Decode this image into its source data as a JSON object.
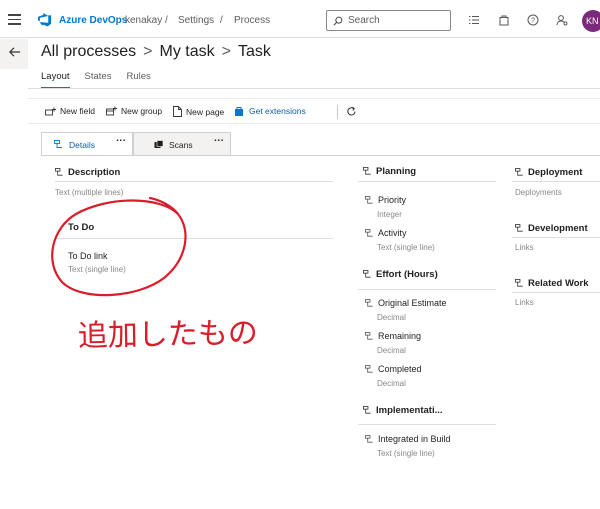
{
  "header": {
    "brand": "Azure DevOps",
    "org": "kenakay",
    "sep1": "/",
    "settings": "Settings",
    "sep2": "/",
    "process": "Process",
    "search_placeholder": "Search",
    "avatar_initials": "KN"
  },
  "breadcrumb": {
    "all": "All processes",
    "mytask": "My task",
    "task": "Task",
    "sep": ">"
  },
  "tabs": {
    "layout": "Layout",
    "states": "States",
    "rules": "Rules"
  },
  "toolbar": {
    "new_field": "New field",
    "new_group": "New group",
    "new_page": "New page",
    "get_extensions": "Get extensions"
  },
  "page_tabs": {
    "details": "Details",
    "scans": "Scans",
    "more": "..."
  },
  "col1": {
    "description": {
      "title": "Description",
      "type": "Text (multiple lines)"
    },
    "todo": {
      "title": "To Do",
      "field": "To Do link",
      "type": "Text (single line)"
    }
  },
  "col2": {
    "planning": {
      "title": "Planning",
      "fields": [
        {
          "label": "Priority",
          "type": "Integer"
        },
        {
          "label": "Activity",
          "type": "Text (single line)"
        }
      ]
    },
    "effort": {
      "title": "Effort (Hours)",
      "fields": [
        {
          "label": "Original Estimate",
          "type": "Decimal"
        },
        {
          "label": "Remaining",
          "type": "Decimal"
        },
        {
          "label": "Completed",
          "type": "Decimal"
        }
      ]
    },
    "implementation": {
      "title": "Implementati...",
      "fields": [
        {
          "label": "Integrated in Build",
          "type": "Text (single line)"
        }
      ]
    }
  },
  "col3": {
    "deployment": {
      "title": "Deployment",
      "type": "Deployments"
    },
    "development": {
      "title": "Development",
      "type": "Links"
    },
    "related": {
      "title": "Related Work",
      "type": "Links"
    }
  },
  "annotation": {
    "text": "追加したもの",
    "color": "#d81e2a"
  },
  "colors": {
    "accent": "#0078d4",
    "avatar": "#7a2a7a",
    "ink": "#d81e2a"
  }
}
